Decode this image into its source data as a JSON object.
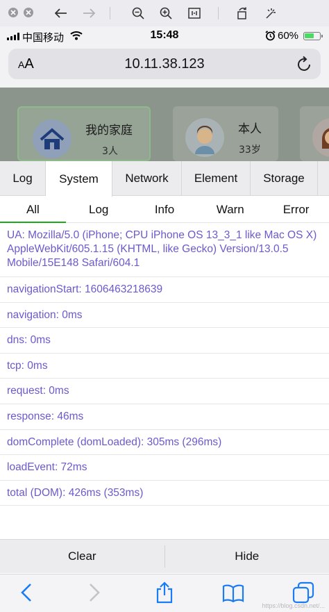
{
  "status_bar": {
    "carrier": "中国移动",
    "time": "15:48",
    "battery_percent": "60%",
    "battery_level": 0.6,
    "battery_color": "#4cd964"
  },
  "url_bar": {
    "text_size_label": "AA",
    "url": "10.11.38.123"
  },
  "page": {
    "cards": [
      {
        "name": "我的家庭",
        "sub": "3人",
        "icon": "home-icon",
        "active": true
      },
      {
        "name": "本人",
        "sub": "33岁",
        "icon": "boy-avatar-icon",
        "active": false
      },
      {
        "name": "",
        "sub": "",
        "icon": "girl-avatar-icon",
        "active": false
      }
    ]
  },
  "vconsole": {
    "tabs": [
      "Log",
      "System",
      "Network",
      "Element",
      "Storage"
    ],
    "active_tab": "System",
    "subtabs": [
      "All",
      "Log",
      "Info",
      "Warn",
      "Error"
    ],
    "active_subtab": "All",
    "log_color": "#6a5acd",
    "accent_color": "#1aad19",
    "logs": [
      "UA: Mozilla/5.0 (iPhone; CPU iPhone OS 13_3_1 like Mac OS X) AppleWebKit/605.1.15 (KHTML, like Gecko) Version/13.0.5 Mobile/15E148 Safari/604.1",
      "navigationStart: 1606463218639",
      "navigation: 0ms",
      "dns: 0ms",
      "tcp: 0ms",
      "request: 0ms",
      "response: 46ms",
      "domComplete (domLoaded): 305ms (296ms)",
      "loadEvent: 72ms",
      "total (DOM): 426ms (353ms)"
    ],
    "footer": {
      "clear_label": "Clear",
      "hide_label": "Hide"
    }
  },
  "watermark": "https://blog.csdn.net/..."
}
